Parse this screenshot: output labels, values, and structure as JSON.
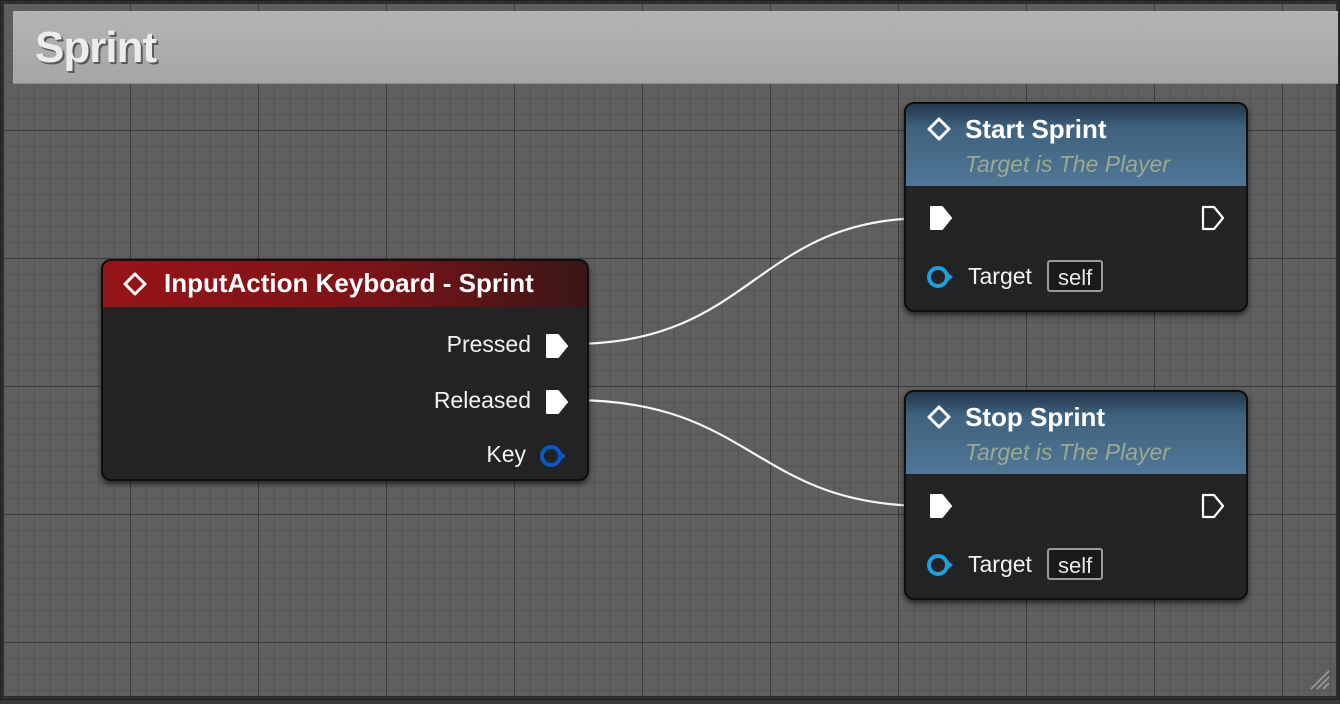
{
  "comment": {
    "title": "Sprint"
  },
  "nodes": {
    "input_action": {
      "title": "InputAction Keyboard - Sprint",
      "header_color": "#8f1418",
      "pins": [
        {
          "label": "Pressed",
          "kind": "exec"
        },
        {
          "label": "Released",
          "kind": "exec"
        },
        {
          "label": "Key",
          "kind": "struct"
        }
      ]
    },
    "start_sprint": {
      "title": "Start Sprint",
      "subtitle": "Target is The Player",
      "header_color": "#4c6f8a",
      "target_label": "Target",
      "target_value": "self"
    },
    "stop_sprint": {
      "title": "Stop Sprint",
      "subtitle": "Target is The Player",
      "header_color": "#4c6f8a",
      "target_label": "Target",
      "target_value": "self"
    }
  },
  "connections": [
    {
      "from": "input_action.Pressed",
      "to": "start_sprint.exec_in"
    },
    {
      "from": "input_action.Released",
      "to": "stop_sprint.exec_in"
    }
  ],
  "colors": {
    "exec_pin": "#ffffff",
    "object_pin": "#1ea0e0",
    "struct_pin": "#0a58c8",
    "wire": "#f5f5f5"
  },
  "icons": {
    "node_icon": "diamond-function-icon",
    "exec_pin": "exec-arrow-icon",
    "object_pin": "object-pin-icon",
    "struct_pin": "struct-pin-icon",
    "resize": "resize-grip-icon"
  }
}
